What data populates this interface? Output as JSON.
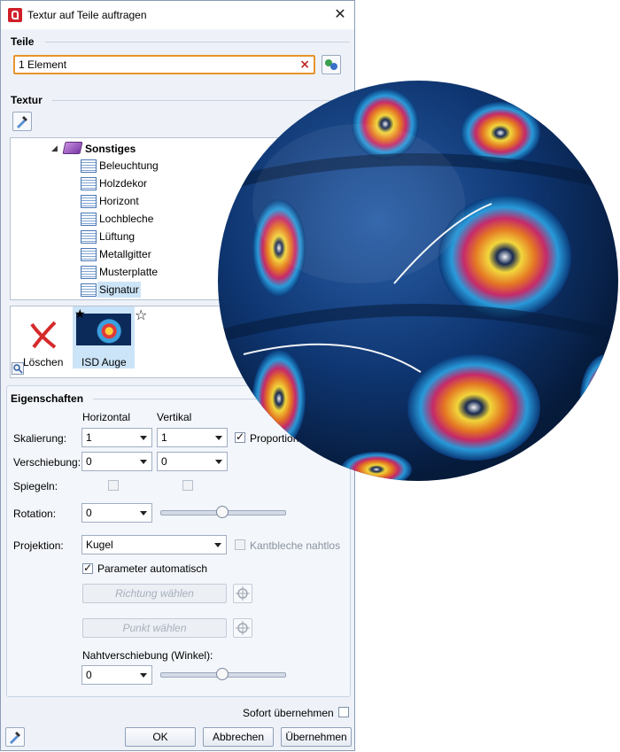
{
  "window": {
    "title": "Textur auf Teile auftragen",
    "close": "✕"
  },
  "teile": {
    "label": "Teile",
    "value": "1 Element"
  },
  "textur": {
    "label": "Textur",
    "tree": {
      "parent": "Sonstiges",
      "items": [
        "Beleuchtung",
        "Holzdekor",
        "Horizont",
        "Lochbleche",
        "Lüftung",
        "Metallgitter",
        "Musterplatte",
        "Signatur"
      ],
      "selected": "Signatur"
    },
    "thumbs": [
      {
        "label": "Löschen"
      },
      {
        "label": "ISD Auge"
      }
    ]
  },
  "props": {
    "label": "Eigenschaften",
    "col_h": "Horizontal",
    "col_v": "Vertikal",
    "scale_label": "Skalierung:",
    "scale_h": "1",
    "scale_v": "1",
    "proportional": "Proportional",
    "shift_label": "Verschiebung:",
    "shift_h": "0",
    "shift_v": "0",
    "mirror_label": "Spiegeln:",
    "rotation_label": "Rotation:",
    "rotation_value": "0",
    "rotation_slider": 0.5,
    "proj_label": "Projektion:",
    "proj_value": "Kugel",
    "kantbleche": "Kantbleche nahtlos",
    "param_auto": "Parameter automatisch",
    "richtung": "Richtung wählen",
    "punkt": "Punkt wählen",
    "naht_label": "Nahtverschiebung (Winkel):",
    "naht_value": "0",
    "naht_slider": 0.5
  },
  "footer": {
    "sofort": "Sofort übernehmen",
    "ok": "OK",
    "abbrechen": "Abbrechen",
    "uebernehmen": "Übernehmen"
  },
  "colors": {
    "accent_orange": "#e8932d",
    "selection": "#cce4f7",
    "sphere_dark": "#0b2a5a"
  }
}
